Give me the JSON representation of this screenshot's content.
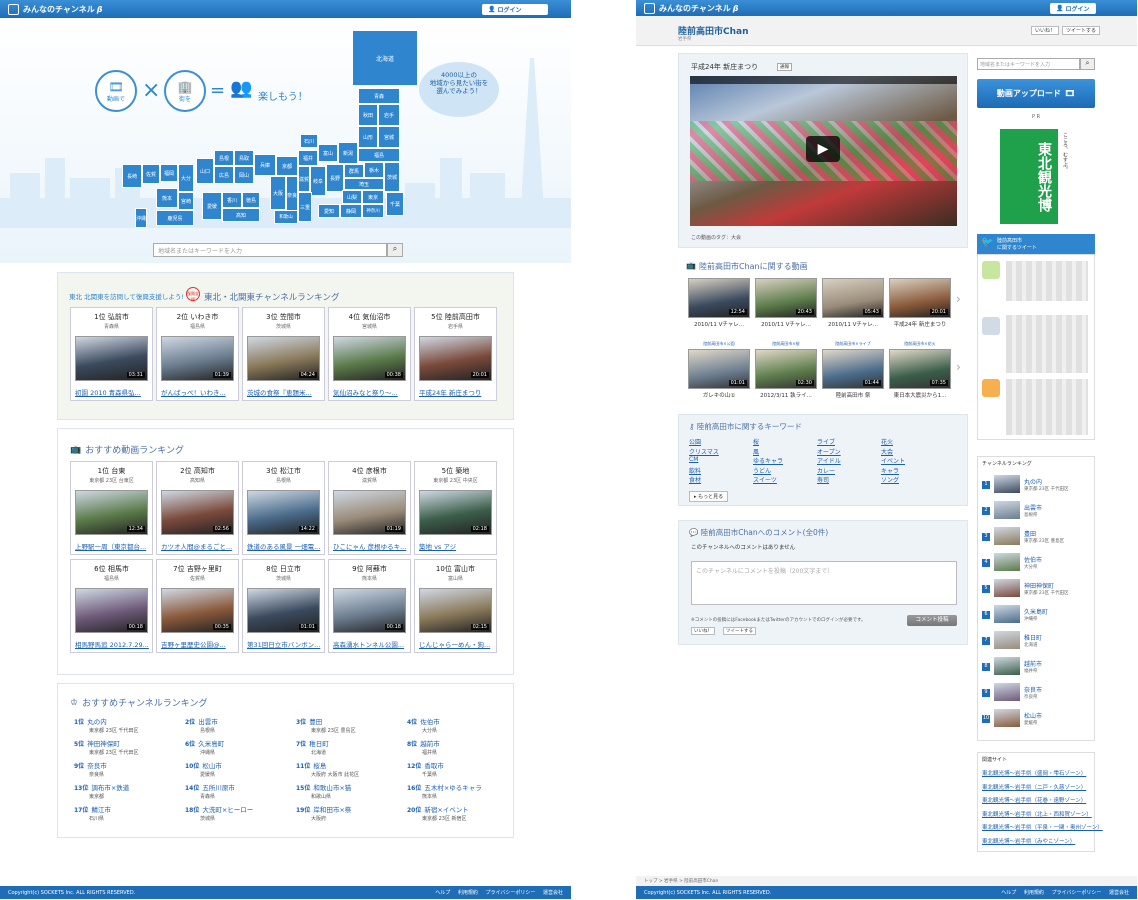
{
  "site": {
    "logo": "みんなのチャンネル",
    "beta": "β",
    "login": "ログイン"
  },
  "left": {
    "hero": {
      "movie": "動画で",
      "town": "街を",
      "enjoy": "楽しもう！",
      "bubble": "4000以上の\n地域から見たい街を\n選んでみよう！"
    },
    "prefs": {
      "hokkaido": "北海道",
      "aomori": "青森",
      "akita": "秋田",
      "iwate": "岩手",
      "yamagata": "山形",
      "miyagi": "宮城",
      "niigata": "新潟",
      "fukushima": "福島",
      "ishikawa": "石川",
      "toyama": "富山",
      "gunma": "群馬",
      "tochigi": "栃木",
      "ibaraki": "茨城",
      "fukui": "福井",
      "nagano": "長野",
      "saitama": "埼玉",
      "tokyo": "東京",
      "chiba": "千葉",
      "yamanashi": "山梨",
      "kanagawa": "神奈川",
      "gifu": "岐阜",
      "shizuoka": "静岡",
      "aichi": "愛知",
      "kyoto": "京都",
      "shiga": "滋賀",
      "mie": "三重",
      "osaka": "大阪",
      "nara": "奈良",
      "wakayama": "和歌山",
      "hyogo": "兵庫",
      "tottori": "鳥取",
      "shimane": "島根",
      "okayama": "岡山",
      "hiroshima": "広島",
      "yamaguchi": "山口",
      "kagawa": "香川",
      "tokushima": "徳島",
      "ehime": "愛媛",
      "kochi": "高知",
      "fukuoka": "福岡",
      "saga": "佐賀",
      "nagasaki": "長崎",
      "oita": "大分",
      "kumamoto": "熊本",
      "miyazaki": "宮崎",
      "kagoshima": "鹿児島",
      "okinawa": "沖縄"
    },
    "search_placeholder": "地域名またはキーワードを入力",
    "tohoku": {
      "banner": "東北 北関東を訪問して復興支援しよう!",
      "badge": "復興支援",
      "title": "東北・北関東チャンネルランキング",
      "cards": [
        {
          "rank": "1位 弘前市",
          "pref": "青森県",
          "dur": "03:31",
          "title": "初園 2010 青森県弘..."
        },
        {
          "rank": "2位 いわき市",
          "pref": "福島県",
          "dur": "01:39",
          "title": "がんばっぺ！いわき..."
        },
        {
          "rank": "3位 笠間市",
          "pref": "茨城県",
          "dur": "04:24",
          "title": "茨城の食祭『恵題米..."
        },
        {
          "rank": "4位 気仙沼市",
          "pref": "宮城県",
          "dur": "00:38",
          "title": "気仙沼みなと祭り〜..."
        },
        {
          "rank": "5位 陸前高田市",
          "pref": "岩手県",
          "dur": "20:01",
          "title": "平成24年 新庄まつり"
        }
      ]
    },
    "videos": {
      "title": "おすすめ動画ランキング",
      "cards": [
        {
          "rank": "1位 台東",
          "pref": "東京都 23区 台東区",
          "dur": "12:34",
          "title": "上野駅一周（東京都台..."
        },
        {
          "rank": "2位 高知市",
          "pref": "高知県",
          "dur": "02:56",
          "title": "カツオ人間@まるごと..."
        },
        {
          "rank": "3位 松江市",
          "pref": "島根県",
          "dur": "14:22",
          "title": "鉄道のある風景 一畑電..."
        },
        {
          "rank": "4位 彦根市",
          "pref": "滋賀県",
          "dur": "01:19",
          "title": "ひこにゃん 彦根ゆるキ..."
        },
        {
          "rank": "5位 築地",
          "pref": "東京都 23区 中央区",
          "dur": "02:18",
          "title": "築地 vs アジ"
        },
        {
          "rank": "6位 相馬市",
          "pref": "福島県",
          "dur": "00:18",
          "title": "相馬野馬追 2012.7.29..."
        },
        {
          "rank": "7位 吉野ヶ里町",
          "pref": "佐賀県",
          "dur": "00:35",
          "title": "吉野ヶ里歴史公園@..."
        },
        {
          "rank": "8位 日立市",
          "pref": "茨城県",
          "dur": "01:01",
          "title": "第31回日立市バンボン..."
        },
        {
          "rank": "9位 阿蘇市",
          "pref": "熊本県",
          "dur": "00:18",
          "title": "高森湧水トンネル公園..."
        },
        {
          "rank": "10位 富山市",
          "pref": "富山県",
          "dur": "02:15",
          "title": "じんじゃら一めん・狗..."
        }
      ]
    },
    "channels": {
      "title": "おすすめチャンネルランキング",
      "items": [
        {
          "n": "1位",
          "name": "丸の内",
          "sub": "東京都 23区 千代田区"
        },
        {
          "n": "2位",
          "name": "出雲市",
          "sub": "島根県"
        },
        {
          "n": "3位",
          "name": "豊田",
          "sub": "東京都 23区 豊島区"
        },
        {
          "n": "4位",
          "name": "佐伯市",
          "sub": "大分県"
        },
        {
          "n": "5位",
          "name": "神田神保町",
          "sub": "東京都 23区 千代田区"
        },
        {
          "n": "6位",
          "name": "久米島町",
          "sub": "沖縄県"
        },
        {
          "n": "7位",
          "name": "稚日町",
          "sub": "北海道"
        },
        {
          "n": "8位",
          "name": "越前市",
          "sub": "福井県"
        },
        {
          "n": "9位",
          "name": "奈良市",
          "sub": "奈良県"
        },
        {
          "n": "10位",
          "name": "松山市",
          "sub": "愛媛県"
        },
        {
          "n": "11位",
          "name": "桜島",
          "sub": "大阪府 大阪市 此花区"
        },
        {
          "n": "12位",
          "name": "香取市",
          "sub": "千葉県"
        },
        {
          "n": "13位",
          "name": "調布市×鉄道",
          "sub": "東京都"
        },
        {
          "n": "14位",
          "name": "五所川原市",
          "sub": "青森県"
        },
        {
          "n": "15位",
          "name": "和歌山市×猫",
          "sub": "和歌山県"
        },
        {
          "n": "16位",
          "name": "五木村×ゆるキャラ",
          "sub": "熊本県"
        },
        {
          "n": "17位",
          "name": "鯖江市",
          "sub": "石川県"
        },
        {
          "n": "18位",
          "name": "大洗町×ヒーロー",
          "sub": "茨城県"
        },
        {
          "n": "19位",
          "name": "岸和田市×祭",
          "sub": "大阪府"
        },
        {
          "n": "20位",
          "name": "新宿×イベント",
          "sub": "東京都 23区 新宿区"
        }
      ]
    },
    "footer": {
      "copy": "Copyright(c) SOCKETS Inc. ALL RIGHTS RESERVED.",
      "links": [
        "ヘルプ",
        "利用規約",
        "プライバシーポリシー",
        "運営会社"
      ]
    }
  },
  "right": {
    "channel_title": "陸前高田市Chan",
    "channel_sub": "岩手県",
    "like": "いいね！",
    "tweet": "ツイートする",
    "video": {
      "title": "平成24年 新庄まつり",
      "tag_btn": "通報",
      "tags": "この動画のタグ：大会"
    },
    "related": {
      "title": "陸前高田市Chanに関する動画",
      "row1": [
        {
          "dur": "12:54",
          "cap": "2010/11 Vチャレ..."
        },
        {
          "dur": "20:43",
          "cap": "2010/11 Vチャレ..."
        },
        {
          "dur": "05:43",
          "cap": "2010/11 Vチャレ..."
        },
        {
          "dur": "20:01",
          "cap": "平成24年 新庄まつり"
        }
      ],
      "row2": [
        {
          "dur": "01:01",
          "cap": "ガレキの山①",
          "head": "陸前高田市×公園"
        },
        {
          "dur": "02:30",
          "cap": "2012/3/11 執ライ...",
          "head": "陸前高田市×桜"
        },
        {
          "dur": "01:44",
          "cap": "陸前高田市 祭",
          "head": "陸前高田市×ライブ"
        },
        {
          "dur": "07:35",
          "cap": "東日本大震災から1...",
          "head": "陸前高田市×花火"
        }
      ]
    },
    "keywords": {
      "title": "陸前高田市に関するキーワード",
      "items": [
        "公園",
        "桜",
        "ライブ",
        "花火",
        "クリスマス",
        "風",
        "オープン",
        "大会",
        "CM",
        "ゆるキャラ",
        "アイドル",
        "イベント",
        "飲料",
        "うどん",
        "カレー",
        "キャラ",
        "食材",
        "スイーツ",
        "寿司",
        "ソング"
      ],
      "more": "もっと見る"
    },
    "comments": {
      "title": "陸前高田市Chanへのコメント(全0件)",
      "none": "このチャンネルへのコメントはありません",
      "placeholder": "このチャンネルにコメントを投稿（200文字まで）",
      "note": "※コメントの投稿にはFacebookまたはTwitterのアカウントでのログインが必要です。",
      "submit": "コメント投稿"
    },
    "side": {
      "search_placeholder": "地域名またはキーワードを入力",
      "upload": "動画アップロード",
      "pr": "P R",
      "ad": "東北観光博",
      "ad_sub": "こころ、むすぶ。",
      "tw_title": "陸前高田市\nに関するツイート",
      "ranking_title": "チャンネルランキング",
      "ranking": [
        {
          "name": "丸の内",
          "sub": "東京都 23区 千代田区"
        },
        {
          "name": "出雲市",
          "sub": "島根県"
        },
        {
          "name": "豊田",
          "sub": "東京都 23区 豊島区"
        },
        {
          "name": "佐伯市",
          "sub": "大分県"
        },
        {
          "name": "神田神保町",
          "sub": "東京都 23区 千代田区"
        },
        {
          "name": "久米島町",
          "sub": "沖縄県"
        },
        {
          "name": "稚日町",
          "sub": "北海道"
        },
        {
          "name": "越前市",
          "sub": "福井県"
        },
        {
          "name": "奈良市",
          "sub": "奈良県"
        },
        {
          "name": "松山市",
          "sub": "愛媛県"
        }
      ],
      "sites_title": "関連サイト",
      "sites": [
        "東北観光博～岩手県（盛岡・雫石ゾーン）",
        "東北観光博～岩手県（二戸・久慈ゾーン）",
        "東北観光博～岩手県（花巻・遠野ゾーン）",
        "東北観光博～岩手県（北上・西和賀ゾーン）",
        "東北観光博～岩手県（平泉・一関・奥州ゾーン）",
        "東北観光博～岩手県（みやこゾーン）"
      ]
    },
    "breadcrumb": [
      "トップ",
      "岩手県",
      "陸前高田市Chan"
    ]
  },
  "colors": {
    "brand": "#1e6db6",
    "accent": "#2f86cf"
  }
}
